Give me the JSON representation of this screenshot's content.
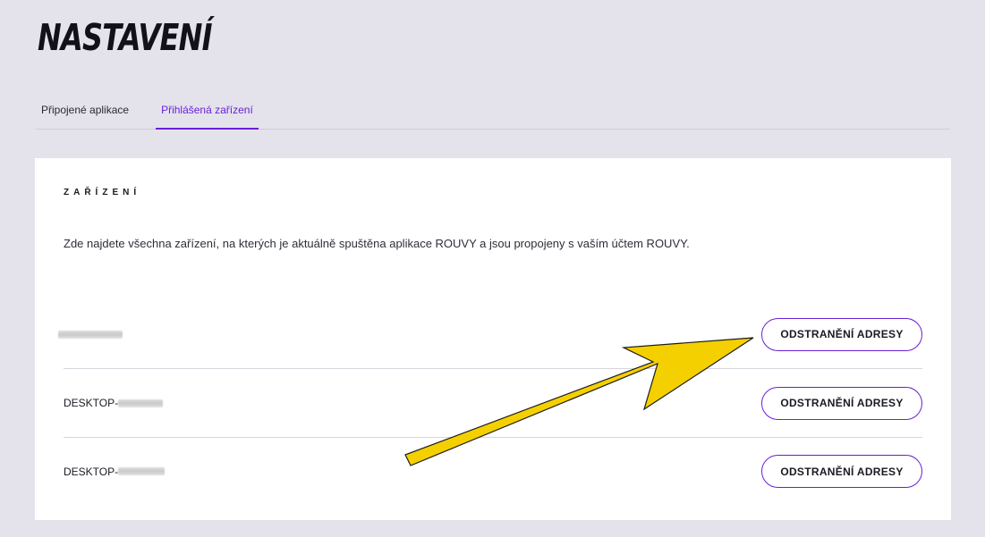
{
  "page": {
    "title": "NASTAVENÍ"
  },
  "tabs": [
    {
      "label": "Připojené aplikace",
      "active": false
    },
    {
      "label": "Přihlášená zařízení",
      "active": true
    }
  ],
  "devices_section": {
    "title": "ZAŘÍZENÍ",
    "description": "Zde najdete všechna zařízení, na kterých je aktuálně spuštěna aplikace ROUVY a jsou propojeny s vaším účtem ROUVY.",
    "remove_label": "ODSTRANĚNÍ ADRESY",
    "devices": [
      {
        "name_prefix": "",
        "name_redacted": true
      },
      {
        "name_prefix": "DESKTOP-",
        "name_redacted": true
      },
      {
        "name_prefix": "DESKTOP-",
        "name_redacted": true
      }
    ]
  },
  "colors": {
    "background": "#e4e3ec",
    "accent": "#6a1fd6",
    "annotation_arrow": "#f5d000"
  },
  "annotation": {
    "type": "arrow",
    "points_to": "remove-button-1"
  }
}
